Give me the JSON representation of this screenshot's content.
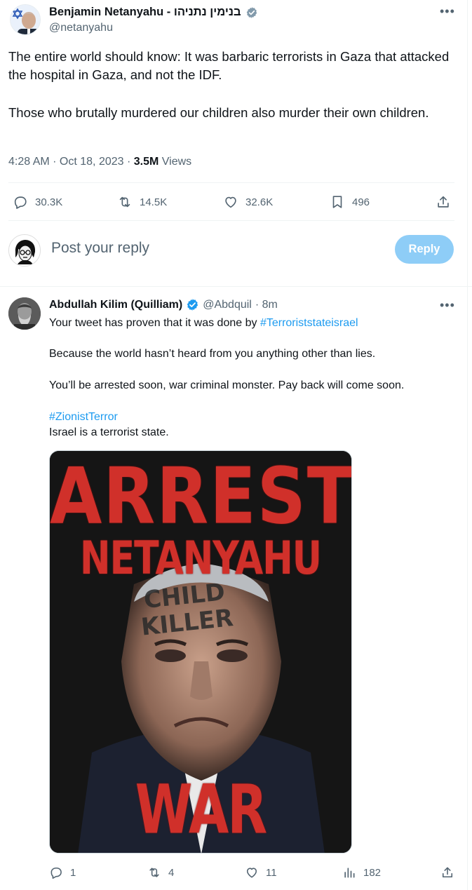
{
  "main_tweet": {
    "display_name": "Benjamin Netanyahu - בנימין נתניהו",
    "handle": "@netanyahu",
    "text_p1": "The entire world should know: It was barbaric terrorists in Gaza that attacked the hospital in Gaza, and not the IDF.",
    "text_p2": "Those who brutally murdered our children also murder their own children.",
    "timestamp": "4:28 AM · Oct 18, 2023 · ",
    "views_count": "3.5M",
    "views_label": " Views",
    "actions": {
      "replies": "30.3K",
      "reposts": "14.5K",
      "likes": "32.6K",
      "bookmarks": "496"
    }
  },
  "composer": {
    "placeholder": "Post your reply",
    "button_label": "Reply"
  },
  "reply_tweet": {
    "display_name": "Abdullah Kilim (Quilliam)",
    "handle": "@Abdquil",
    "time": "· 8m",
    "line1_text": "Your tweet has proven that it was done by ",
    "line1_hashtag": "#Terroriststateisrael",
    "line2": "Because the world hasn’t heard from you anything other than lies.",
    "line3": "You’ll be arrested soon, war criminal monster. Pay back will come soon.",
    "hashtag2": "#ZionistTerror",
    "line4": "Israel is a terrorist state.",
    "poster": {
      "line1": "ARREST",
      "line2": "NETANYAHU",
      "stamp_line1": "CHILD",
      "stamp_line2": "KILLER",
      "line3": "WAR CRIMINAL"
    },
    "actions": {
      "replies": "1",
      "reposts": "4",
      "likes": "11",
      "views": "182"
    }
  },
  "colors": {
    "accent": "#1d9bf0",
    "reply_button": "#8ecdf7",
    "muted_text": "#536471",
    "poster_red": "#d0302a"
  }
}
